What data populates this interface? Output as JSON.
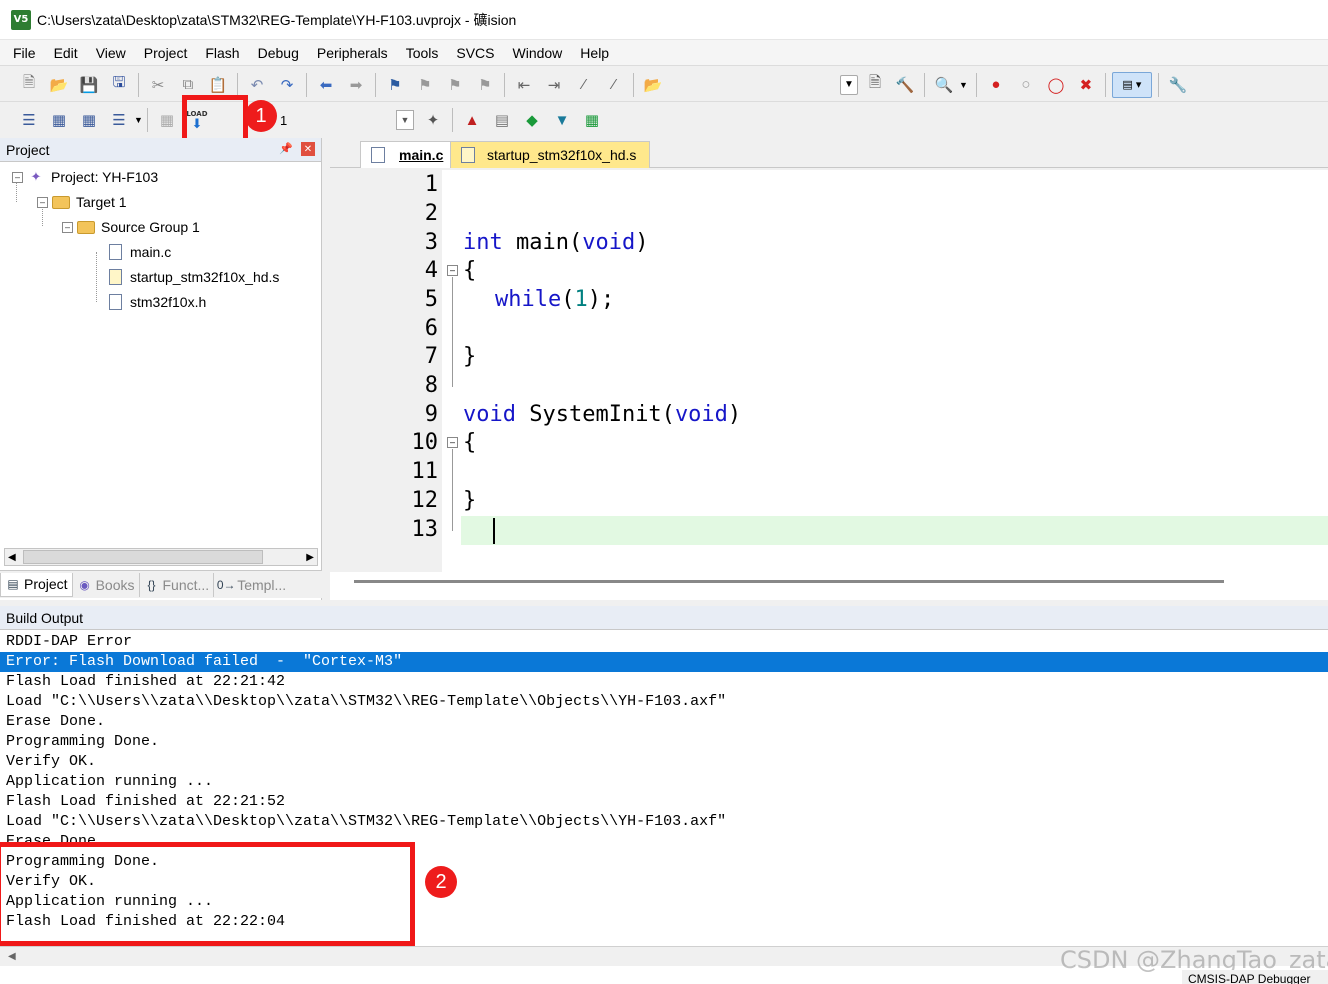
{
  "window": {
    "title": "C:\\Users\\zata\\Desktop\\zata\\STM32\\REG-Template\\YH-F103.uvprojx - 礦ision",
    "app_icon_text": "V5"
  },
  "menu": [
    "File",
    "Edit",
    "View",
    "Project",
    "Flash",
    "Debug",
    "Peripherals",
    "Tools",
    "SVCS",
    "Window",
    "Help"
  ],
  "toolbar2": {
    "load_badge": "LOAD",
    "target_value": "1"
  },
  "annotations": {
    "marker1": "1",
    "marker2": "2",
    "accent_color": "#ee1c1c"
  },
  "project_panel": {
    "title": "Project",
    "tree": {
      "project": "Project: YH-F103",
      "target": "Target 1",
      "group": "Source Group 1",
      "files": [
        "main.c",
        "startup_stm32f10x_hd.s",
        "stm32f10x.h"
      ]
    },
    "tabs": [
      "Project",
      "Books",
      "Funct...",
      "Templ..."
    ],
    "tab_icons": [
      "",
      "",
      "{}",
      "0→"
    ]
  },
  "editor": {
    "tabs": [
      "main.c",
      "startup_stm32f10x_hd.s"
    ],
    "line_numbers": [
      "1",
      "2",
      "3",
      "4",
      "5",
      "6",
      "7",
      "8",
      "9",
      "10",
      "11",
      "12",
      "13"
    ],
    "lines": {
      "l3_kw": "int",
      "l3_rest": " main(",
      "l3_kw2": "void",
      "l3_end": ")",
      "l4": "{",
      "l5_kw": "while",
      "l5_open": "(",
      "l5_num": "1",
      "l5_end": ");",
      "l7": "}",
      "l9_kw": "void",
      "l9_rest": " SystemInit(",
      "l9_kw2": "void",
      "l9_end": ")",
      "l10": "{",
      "l12": "}"
    }
  },
  "build_output": {
    "title": "Build Output",
    "lines": [
      "RDDI-DAP Error",
      "Error: Flash Download failed  -  \"Cortex-M3\"",
      "Flash Load finished at 22:21:42",
      "Load \"C:\\\\Users\\\\zata\\\\Desktop\\\\zata\\\\STM32\\\\REG-Template\\\\Objects\\\\YH-F103.axf\"",
      "Erase Done.",
      "Programming Done.",
      "Verify OK.",
      "Application running ...",
      "Flash Load finished at 22:21:52",
      "Load \"C:\\\\Users\\\\zata\\\\Desktop\\\\zata\\\\STM32\\\\REG-Template\\\\Objects\\\\YH-F103.axf\"",
      "Erase Done.",
      "Programming Done.",
      "Verify OK.",
      "Application running ...",
      "Flash Load finished at 22:22:04"
    ],
    "selected_index": 1,
    "selection_color": "#0a78d7"
  },
  "status_bar": {
    "debugger": "CMSIS-DAP Debugger"
  },
  "watermark": "CSDN @ZhangTao_zata"
}
